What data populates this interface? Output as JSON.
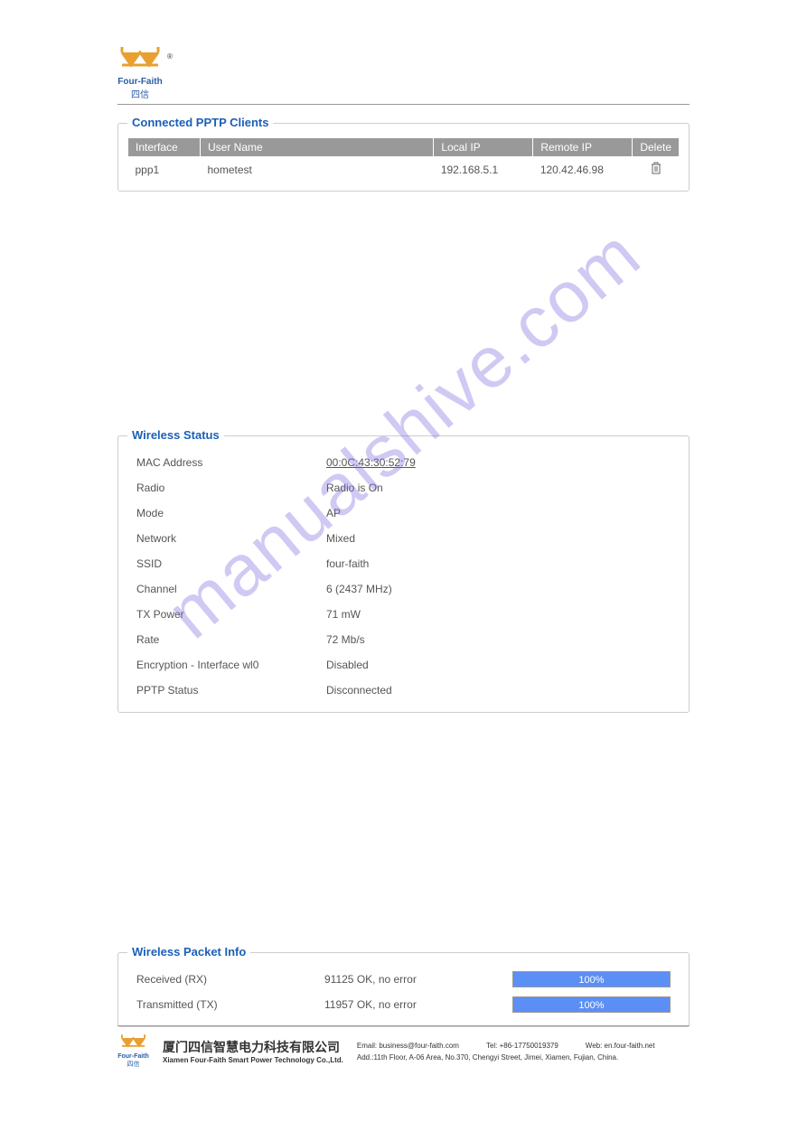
{
  "brand": {
    "name": "Four-Faith",
    "sub": "四信"
  },
  "pptp": {
    "title": "Connected PPTP Clients",
    "headers": {
      "interface": "Interface",
      "username": "User Name",
      "localip": "Local IP",
      "remoteip": "Remote IP",
      "delete": "Delete"
    },
    "rows": [
      {
        "interface": "ppp1",
        "username": "hometest",
        "localip": "192.168.5.1",
        "remoteip": "120.42.46.98"
      }
    ]
  },
  "wireless_status": {
    "title": "Wireless Status",
    "rows": [
      {
        "label": "MAC Address",
        "value": "00:0C:43:30:52:79",
        "underline": true
      },
      {
        "label": "Radio",
        "value": "Radio is On"
      },
      {
        "label": "Mode",
        "value": "AP"
      },
      {
        "label": "Network",
        "value": "Mixed"
      },
      {
        "label": "SSID",
        "value": "four-faith"
      },
      {
        "label": "Channel",
        "value": "6 (2437 MHz)"
      },
      {
        "label": "TX Power",
        "value": "71 mW"
      },
      {
        "label": "Rate",
        "value": "72 Mb/s"
      },
      {
        "label": "Encryption - Interface wl0",
        "value": "Disabled"
      },
      {
        "label": "PPTP Status",
        "value": "Disconnected"
      }
    ]
  },
  "packet_info": {
    "title": "Wireless Packet Info",
    "rows": [
      {
        "label": "Received (RX)",
        "value": "91125 OK, no error",
        "percent": "100%"
      },
      {
        "label": "Transmitted (TX)",
        "value": "11957 OK, no error",
        "percent": "100%"
      }
    ]
  },
  "footer": {
    "company_cn": "厦门四信智慧电力科技有限公司",
    "company_en": "Xiamen Four-Faith Smart Power Technology Co.,Ltd.",
    "email": "Email: business@four-faith.com",
    "tel": "Tel: +86-17750019379",
    "web": "Web: en.four-faith.net",
    "addr": "Add.:11th Floor, A-06 Area, No.370, Chengyi Street, Jimei, Xiamen, Fujian, China."
  },
  "watermark": "manualshive.com"
}
